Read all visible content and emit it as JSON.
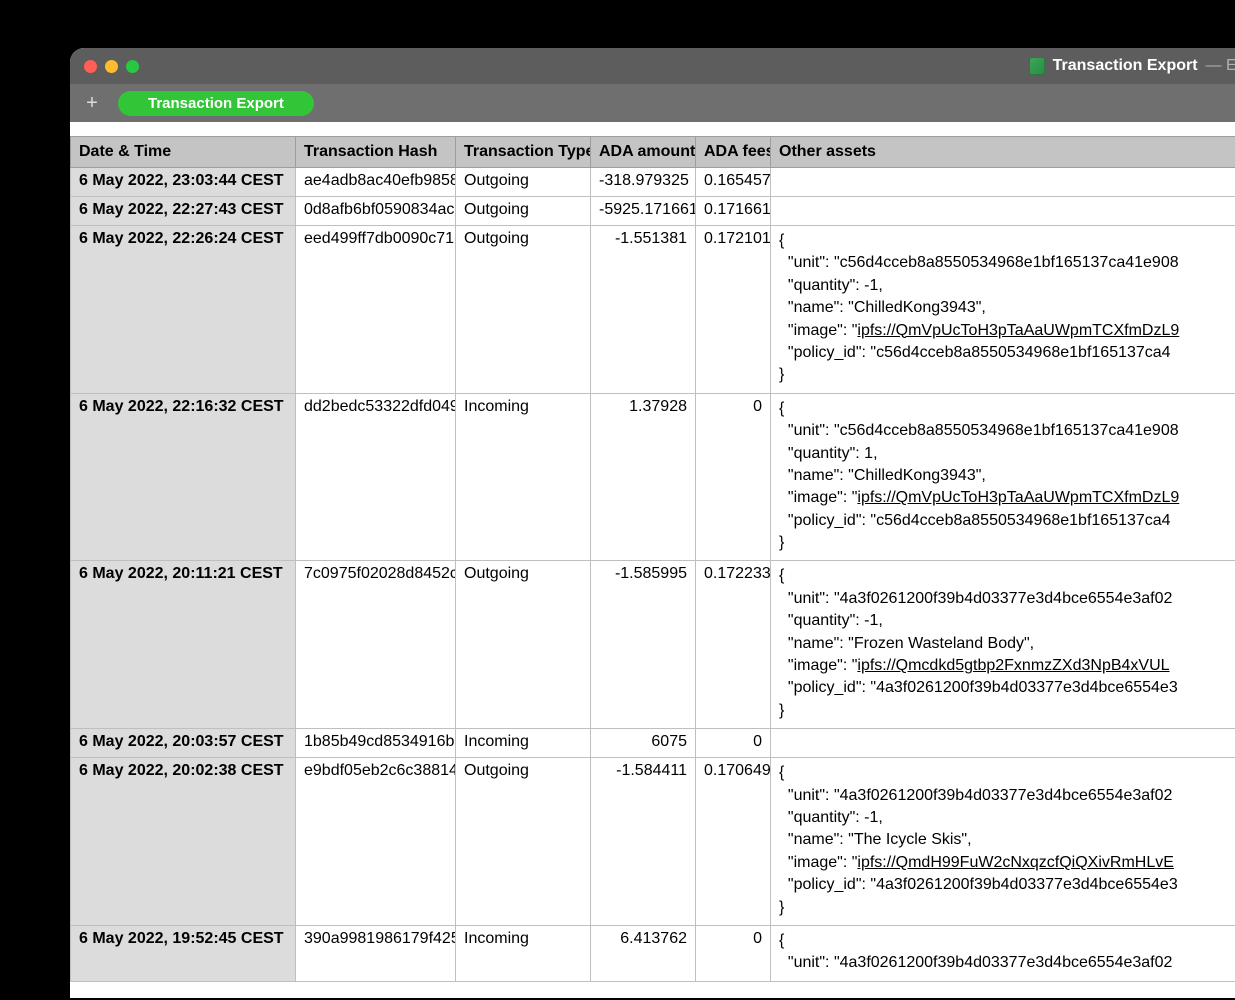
{
  "window": {
    "title": "Transaction Export",
    "edited_label": "—  Edited"
  },
  "tabbar": {
    "plus_label": "+",
    "tab_label": "Transaction Export"
  },
  "table": {
    "headers": {
      "date": "Date & Time",
      "hash": "Transaction Hash",
      "type": "Transaction Type",
      "amount": "ADA amount",
      "fees": "ADA fees",
      "assets": "Other assets"
    },
    "rows": [
      {
        "date": "6 May 2022, 23:03:44 CEST",
        "hash": "ae4adb8ac40efb9858",
        "type": "Outgoing",
        "amount": "-318.979325",
        "fees": "0.165457",
        "assets": ""
      },
      {
        "date": "6 May 2022, 22:27:43 CEST",
        "hash": "0d8afb6bf0590834ac",
        "type": "Outgoing",
        "amount": "-5925.171661",
        "fees": "0.171661",
        "assets": ""
      },
      {
        "date": "6 May 2022, 22:26:24 CEST",
        "hash": "eed499ff7db0090c71",
        "type": "Outgoing",
        "amount": "-1.551381",
        "fees": "0.172101",
        "assets": "{\n  \"unit\": \"c56d4cceb8a8550534968e1bf165137ca41e908\n  \"quantity\": -1,\n  \"name\": \"ChilledKong3943\",\n  \"image\": \"ipfs://QmVpUcToH3pTaAaUWpmTCXfmDzL9\n  \"policy_id\": \"c56d4cceb8a8550534968e1bf165137ca4\n}"
      },
      {
        "date": "6 May 2022, 22:16:32 CEST",
        "hash": "dd2bedc53322dfd049",
        "type": "Incoming",
        "amount": "1.37928",
        "fees": "0",
        "assets": "{\n  \"unit\": \"c56d4cceb8a8550534968e1bf165137ca41e908\n  \"quantity\": 1,\n  \"name\": \"ChilledKong3943\",\n  \"image\": \"ipfs://QmVpUcToH3pTaAaUWpmTCXfmDzL9\n  \"policy_id\": \"c56d4cceb8a8550534968e1bf165137ca4\n}"
      },
      {
        "date": "6 May 2022, 20:11:21 CEST",
        "hash": "7c0975f02028d8452c",
        "type": "Outgoing",
        "amount": "-1.585995",
        "fees": "0.172233",
        "assets": "{\n  \"unit\": \"4a3f0261200f39b4d03377e3d4bce6554e3af02\n  \"quantity\": -1,\n  \"name\": \"Frozen Wasteland Body\",\n  \"image\": \"ipfs://Qmcdkd5gtbp2FxnmzZXd3NpB4xVUL\n  \"policy_id\": \"4a3f0261200f39b4d03377e3d4bce6554e3\n}"
      },
      {
        "date": "6 May 2022, 20:03:57 CEST",
        "hash": "1b85b49cd8534916b",
        "type": "Incoming",
        "amount": "6075",
        "fees": "0",
        "assets": ""
      },
      {
        "date": "6 May 2022, 20:02:38 CEST",
        "hash": "e9bdf05eb2c6c38814",
        "type": "Outgoing",
        "amount": "-1.584411",
        "fees": "0.170649",
        "assets": "{\n  \"unit\": \"4a3f0261200f39b4d03377e3d4bce6554e3af02\n  \"quantity\": -1,\n  \"name\": \"The Icycle Skis\",\n  \"image\": \"ipfs://QmdH99FuW2cNxqzcfQiQXivRmHLvE\n  \"policy_id\": \"4a3f0261200f39b4d03377e3d4bce6554e3\n}"
      },
      {
        "date": "6 May 2022, 19:52:45 CEST",
        "hash": "390a9981986179f425",
        "type": "Incoming",
        "amount": "6.413762",
        "fees": "0",
        "assets": "{\n  \"unit\": \"4a3f0261200f39b4d03377e3d4bce6554e3af02"
      }
    ]
  }
}
